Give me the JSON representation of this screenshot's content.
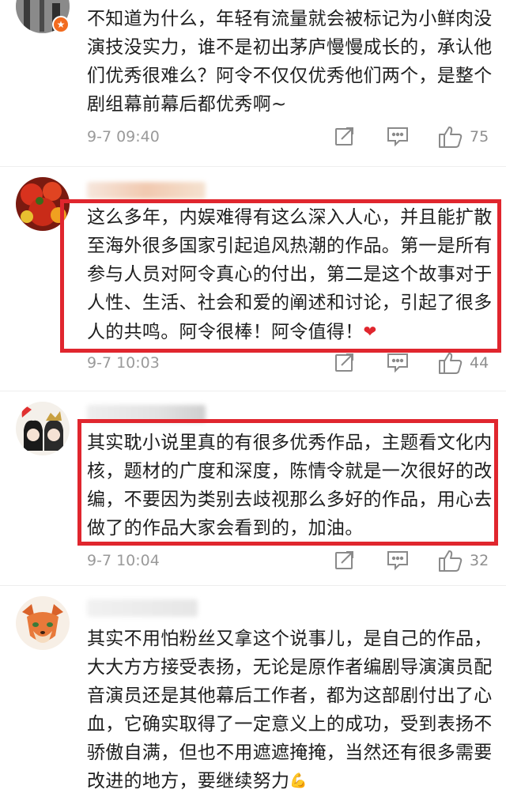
{
  "comments": [
    {
      "text": "不知道为什么，年轻有流量就会被标记为小鲜肉没演技没实力，谁不是初出茅庐慢慢成长的，承认他们优秀很难么？阿令不仅仅优秀他们两个，是整个剧组幕前幕后都优秀啊~",
      "time": "9-7 09:40",
      "likes": "75",
      "highlighted": false
    },
    {
      "text": "这么多年，内娱难得有这么深入人心，并且能扩散至海外很多国家引起追风热潮的作品。第一是所有参与人员对阿令真心的付出，第二是这个故事对于人性、生活、社会和爱的阐述和讨论，引起了很多人的共鸣。阿令很棒！阿令值得！",
      "trailing_icon": "heart-emoji",
      "time": "9-7 10:03",
      "likes": "44",
      "highlighted": true
    },
    {
      "text": "其实耽小说里真的有很多优秀作品，主题看文化内核，题材的广度和深度，陈情令就是一次很好的改编，不要因为类别去歧视那么多好的作品，用心去做了的作品大家会看到的，加油。",
      "time": "9-7 10:04",
      "likes": "32",
      "highlighted": true
    },
    {
      "text": "其实不用怕粉丝又拿这个说事儿，是自己的作品，大大方方接受表扬，无论是原作者编剧导演演员配音演员还是其他幕后工作者，都为这部剧付出了心血，它确实取得了一定意义上的成功，受到表扬不骄傲自满，但也不用遮遮掩掩，当然还有很多需要改进的地方，要继续努力",
      "trailing_icon": "flexed-arm-emoji",
      "highlighted": false
    }
  ],
  "icons": {
    "share": "share-icon",
    "reply": "comment-icon",
    "like": "thumbs-up-icon"
  },
  "colors": {
    "highlight": "#e0262e",
    "meta_text": "#9a9a9a",
    "body_text": "#1e1e1e"
  }
}
